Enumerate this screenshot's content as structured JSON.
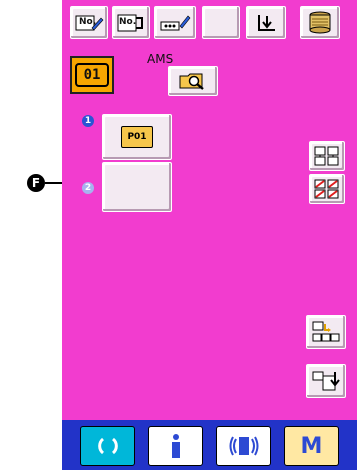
{
  "toolbar": {
    "no_edit_label": "No.",
    "no_copy_label": "No.",
    "blank_label": ""
  },
  "program": {
    "number": "01",
    "ams_label": "AMS"
  },
  "pattern": {
    "step1_badge": "1",
    "step1_label": "P01",
    "step2_badge": "2"
  },
  "annotation": {
    "marker_label": "F"
  },
  "footer": {
    "m_label": "M"
  },
  "colors": {
    "screen_bg": "#f23ccf",
    "footer_bg": "#2233c8",
    "button_face": "#f3eaf2",
    "program_button": "#f7a600",
    "reset_button": "#00b7d9",
    "info_button": "#ffffff",
    "comm_button": "#ffffff",
    "mode_button": "#ffe8a3"
  }
}
